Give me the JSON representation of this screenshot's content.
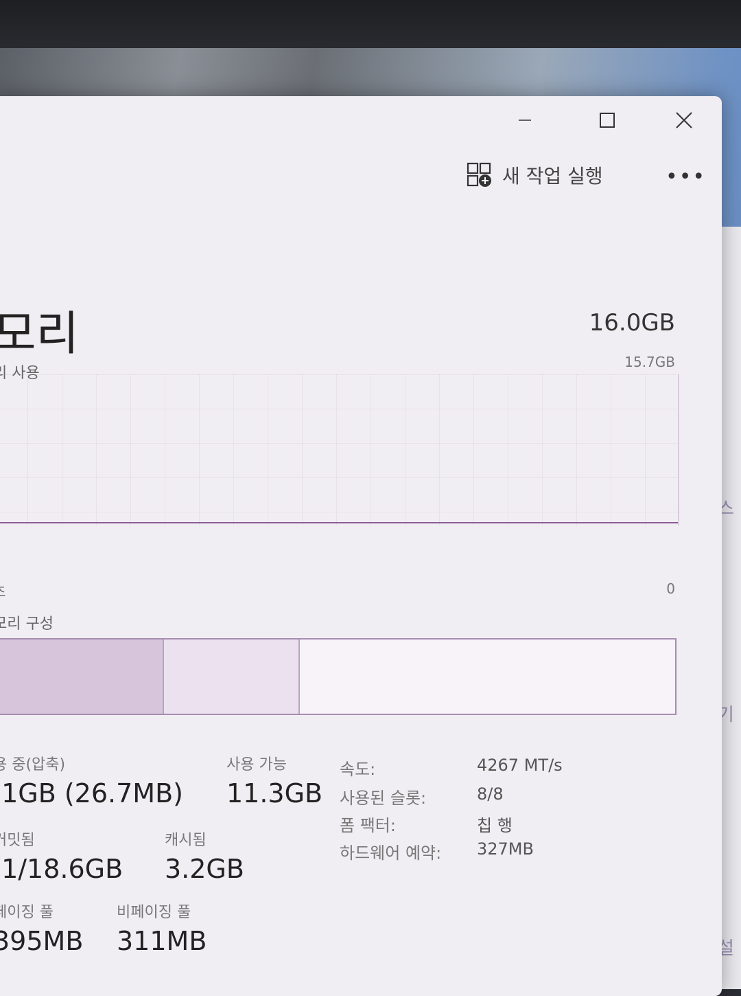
{
  "window": {
    "caption": {
      "minimize_icon": "minimize-icon",
      "maximize_icon": "maximize-icon",
      "close_icon": "close-icon"
    }
  },
  "toolbar": {
    "run_new_task_label": "새 작업 실행",
    "run_new_task_icon": "run-task-icon",
    "more_icon": "more-icon",
    "more_glyph": "•••"
  },
  "memory": {
    "title": "모리",
    "subtitle": "리 사용",
    "total": "16.0GB",
    "graph_max": "15.7GB",
    "axis_left": "초",
    "axis_right": "0",
    "composition_label": "모리 구성",
    "composition": [
      {
        "name": "in-use",
        "fraction": 0.25,
        "color": "#d7c5dc"
      },
      {
        "name": "modified",
        "fraction": 0.2,
        "color": "#ece2ef"
      },
      {
        "name": "standby",
        "fraction": 0.55,
        "color": "#f7f3f8"
      }
    ]
  },
  "stats": {
    "in_use": {
      "label": "용 중(압축)",
      "value": ".1GB (26.7MB)"
    },
    "available": {
      "label": "사용 가능",
      "value": "11.3GB"
    },
    "committed": {
      "label": "커밋됨",
      "value": ".1/18.6GB"
    },
    "cached": {
      "label": "캐시됨",
      "value": "3.2GB"
    },
    "paged_pool": {
      "label": "페이징 풀",
      "value": "395MB"
    },
    "nonpaged_pool": {
      "label": "비페이징 풀",
      "value": "311MB"
    }
  },
  "details": [
    {
      "key": "속도:",
      "value": "4267 MT/s"
    },
    {
      "key": "사용된 슬롯:",
      "value": "8/8"
    },
    {
      "key": "폼 팩터:",
      "value": "칩 행"
    },
    {
      "key": "하드웨어 예약:",
      "value": "327MB"
    }
  ],
  "background_text": [
    "스",
    "기",
    "설"
  ]
}
